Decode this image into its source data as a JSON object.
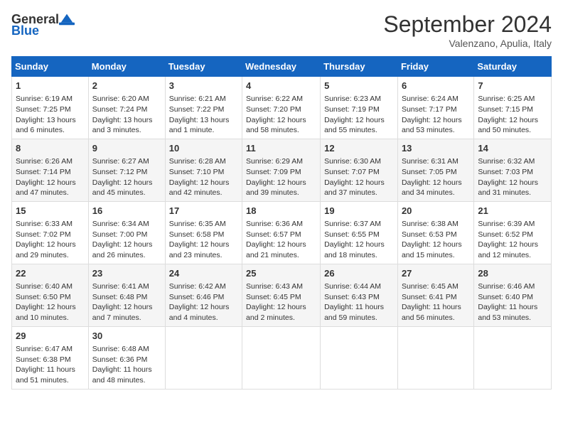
{
  "header": {
    "logo_general": "General",
    "logo_blue": "Blue",
    "month_title": "September 2024",
    "subtitle": "Valenzano, Apulia, Italy"
  },
  "columns": [
    "Sunday",
    "Monday",
    "Tuesday",
    "Wednesday",
    "Thursday",
    "Friday",
    "Saturday"
  ],
  "weeks": [
    [
      {
        "day": "1",
        "info": "Sunrise: 6:19 AM\nSunset: 7:25 PM\nDaylight: 13 hours\nand 6 minutes."
      },
      {
        "day": "2",
        "info": "Sunrise: 6:20 AM\nSunset: 7:24 PM\nDaylight: 13 hours\nand 3 minutes."
      },
      {
        "day": "3",
        "info": "Sunrise: 6:21 AM\nSunset: 7:22 PM\nDaylight: 13 hours\nand 1 minute."
      },
      {
        "day": "4",
        "info": "Sunrise: 6:22 AM\nSunset: 7:20 PM\nDaylight: 12 hours\nand 58 minutes."
      },
      {
        "day": "5",
        "info": "Sunrise: 6:23 AM\nSunset: 7:19 PM\nDaylight: 12 hours\nand 55 minutes."
      },
      {
        "day": "6",
        "info": "Sunrise: 6:24 AM\nSunset: 7:17 PM\nDaylight: 12 hours\nand 53 minutes."
      },
      {
        "day": "7",
        "info": "Sunrise: 6:25 AM\nSunset: 7:15 PM\nDaylight: 12 hours\nand 50 minutes."
      }
    ],
    [
      {
        "day": "8",
        "info": "Sunrise: 6:26 AM\nSunset: 7:14 PM\nDaylight: 12 hours\nand 47 minutes."
      },
      {
        "day": "9",
        "info": "Sunrise: 6:27 AM\nSunset: 7:12 PM\nDaylight: 12 hours\nand 45 minutes."
      },
      {
        "day": "10",
        "info": "Sunrise: 6:28 AM\nSunset: 7:10 PM\nDaylight: 12 hours\nand 42 minutes."
      },
      {
        "day": "11",
        "info": "Sunrise: 6:29 AM\nSunset: 7:09 PM\nDaylight: 12 hours\nand 39 minutes."
      },
      {
        "day": "12",
        "info": "Sunrise: 6:30 AM\nSunset: 7:07 PM\nDaylight: 12 hours\nand 37 minutes."
      },
      {
        "day": "13",
        "info": "Sunrise: 6:31 AM\nSunset: 7:05 PM\nDaylight: 12 hours\nand 34 minutes."
      },
      {
        "day": "14",
        "info": "Sunrise: 6:32 AM\nSunset: 7:03 PM\nDaylight: 12 hours\nand 31 minutes."
      }
    ],
    [
      {
        "day": "15",
        "info": "Sunrise: 6:33 AM\nSunset: 7:02 PM\nDaylight: 12 hours\nand 29 minutes."
      },
      {
        "day": "16",
        "info": "Sunrise: 6:34 AM\nSunset: 7:00 PM\nDaylight: 12 hours\nand 26 minutes."
      },
      {
        "day": "17",
        "info": "Sunrise: 6:35 AM\nSunset: 6:58 PM\nDaylight: 12 hours\nand 23 minutes."
      },
      {
        "day": "18",
        "info": "Sunrise: 6:36 AM\nSunset: 6:57 PM\nDaylight: 12 hours\nand 21 minutes."
      },
      {
        "day": "19",
        "info": "Sunrise: 6:37 AM\nSunset: 6:55 PM\nDaylight: 12 hours\nand 18 minutes."
      },
      {
        "day": "20",
        "info": "Sunrise: 6:38 AM\nSunset: 6:53 PM\nDaylight: 12 hours\nand 15 minutes."
      },
      {
        "day": "21",
        "info": "Sunrise: 6:39 AM\nSunset: 6:52 PM\nDaylight: 12 hours\nand 12 minutes."
      }
    ],
    [
      {
        "day": "22",
        "info": "Sunrise: 6:40 AM\nSunset: 6:50 PM\nDaylight: 12 hours\nand 10 minutes."
      },
      {
        "day": "23",
        "info": "Sunrise: 6:41 AM\nSunset: 6:48 PM\nDaylight: 12 hours\nand 7 minutes."
      },
      {
        "day": "24",
        "info": "Sunrise: 6:42 AM\nSunset: 6:46 PM\nDaylight: 12 hours\nand 4 minutes."
      },
      {
        "day": "25",
        "info": "Sunrise: 6:43 AM\nSunset: 6:45 PM\nDaylight: 12 hours\nand 2 minutes."
      },
      {
        "day": "26",
        "info": "Sunrise: 6:44 AM\nSunset: 6:43 PM\nDaylight: 11 hours\nand 59 minutes."
      },
      {
        "day": "27",
        "info": "Sunrise: 6:45 AM\nSunset: 6:41 PM\nDaylight: 11 hours\nand 56 minutes."
      },
      {
        "day": "28",
        "info": "Sunrise: 6:46 AM\nSunset: 6:40 PM\nDaylight: 11 hours\nand 53 minutes."
      }
    ],
    [
      {
        "day": "29",
        "info": "Sunrise: 6:47 AM\nSunset: 6:38 PM\nDaylight: 11 hours\nand 51 minutes."
      },
      {
        "day": "30",
        "info": "Sunrise: 6:48 AM\nSunset: 6:36 PM\nDaylight: 11 hours\nand 48 minutes."
      },
      null,
      null,
      null,
      null,
      null
    ]
  ]
}
